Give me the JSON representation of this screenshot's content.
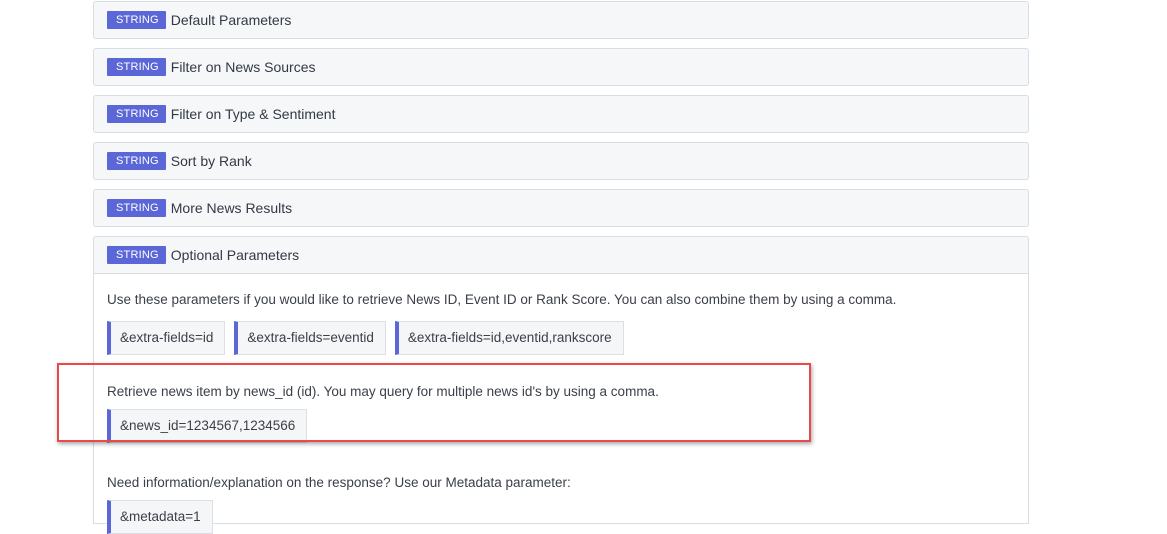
{
  "panels": [
    {
      "badge": "STRING",
      "title": "Default Parameters"
    },
    {
      "badge": "STRING",
      "title": "Filter on News Sources"
    },
    {
      "badge": "STRING",
      "title": "Filter on Type & Sentiment"
    },
    {
      "badge": "STRING",
      "title": "Sort by Rank"
    },
    {
      "badge": "STRING",
      "title": "More News Results"
    },
    {
      "badge": "STRING",
      "title": "Optional Parameters"
    }
  ],
  "optional": {
    "intro": "Use these parameters if you would like to retrieve News ID, Event ID or Rank Score. You can also combine them by using a comma.",
    "codes": [
      "&extra-fields=id",
      "&extra-fields=eventid",
      "&extra-fields=id,eventid,rankscore"
    ],
    "news_id_desc": "Retrieve news item by news_id (id). You may query for multiple news id's by using a comma.",
    "news_id_code": "&news_id=1234567,1234566",
    "metadata_desc": "Need information/explanation on the response? Use our Metadata parameter:",
    "metadata_code": "&metadata=1"
  },
  "colors": {
    "badge": "#5b67d6",
    "highlight": "#e84a4a"
  }
}
